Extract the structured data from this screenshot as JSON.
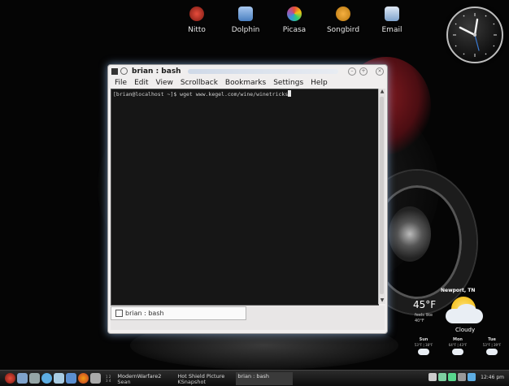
{
  "dock": [
    {
      "label": "Nitto",
      "color": "#c0392b"
    },
    {
      "label": "Dolphin",
      "color": "#6f9fdc"
    },
    {
      "label": "Picasa",
      "color": "#e67e22"
    },
    {
      "label": "Songbird",
      "color": "#f39c12"
    },
    {
      "label": "Email",
      "color": "#8fb3d8"
    }
  ],
  "window": {
    "title": "brian : bash",
    "menu": [
      "File",
      "Edit",
      "View",
      "Scrollback",
      "Bookmarks",
      "Settings",
      "Help"
    ],
    "prompt": "[brian@localhost ~]$ wget www.kegel.com/wine/winetricks",
    "tab_label": "brian : bash"
  },
  "weather": {
    "location": "Newport, TN",
    "temp": "45°F",
    "feels": "feels like 40°F",
    "condition": "Cloudy",
    "days": [
      {
        "name": "Sun",
        "temps": "53°F | 38°F"
      },
      {
        "name": "Mon",
        "temps": "64°F | 43°F"
      },
      {
        "name": "Tue",
        "temps": "53°F | 39°F"
      }
    ]
  },
  "taskbar": {
    "pager": [
      "1",
      "2",
      "3",
      "4"
    ],
    "tasks": [
      {
        "top": "ModernWarfare2",
        "bottom": "Sean"
      },
      {
        "top": "Hot Shield Picture",
        "bottom": "KSnapshot"
      },
      {
        "top": "brian : bash",
        "bottom": ""
      }
    ],
    "time": "12:46 pm"
  },
  "colors": {
    "window_glow": "#8cb4e6",
    "terminal_bg": "#161616"
  }
}
